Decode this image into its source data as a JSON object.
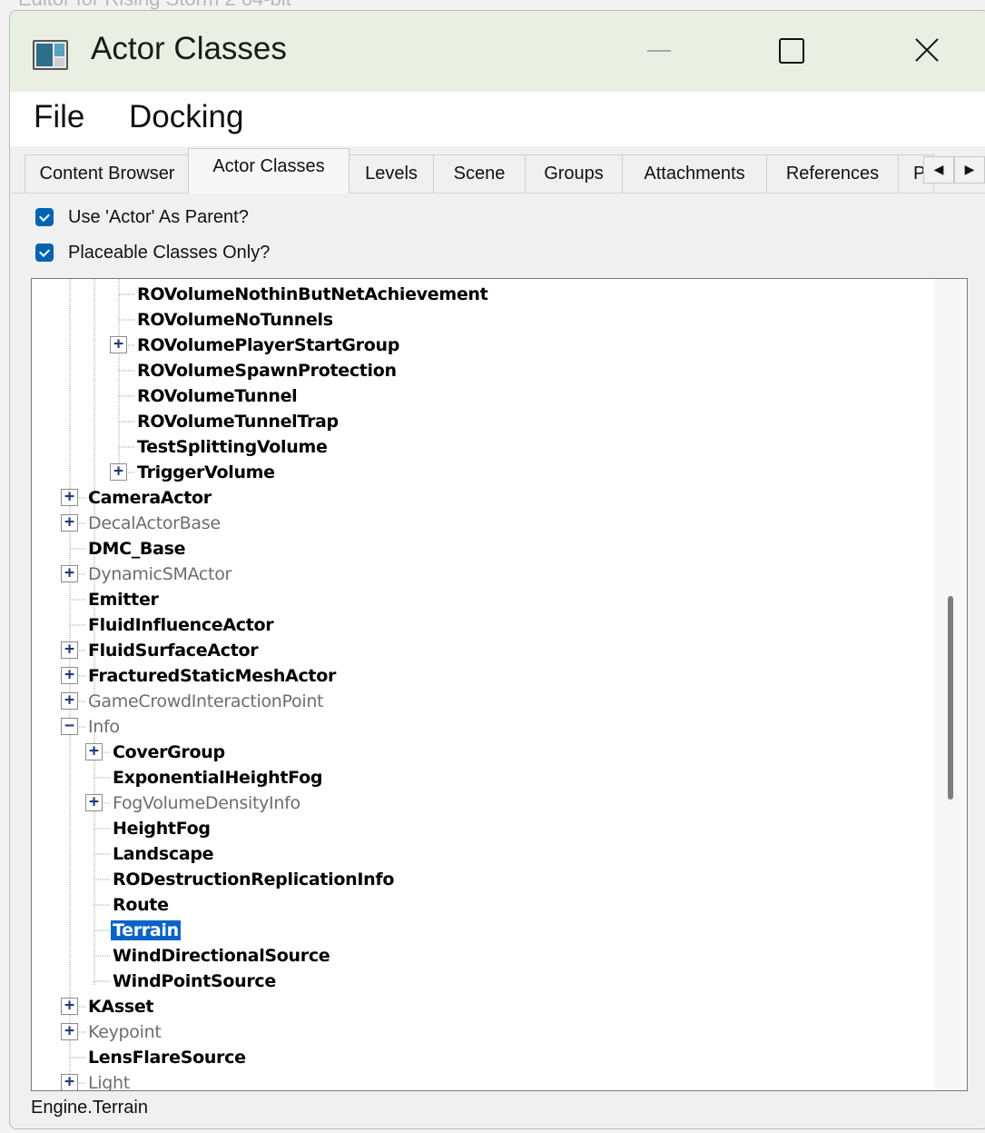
{
  "background_window": {
    "title_fragment": "Editor for Rising Storm 2 64-bit"
  },
  "window": {
    "title": "Actor Classes",
    "icon": "app-window-icon"
  },
  "menu": {
    "file": "File",
    "docking": "Docking"
  },
  "tabs": [
    {
      "label": "Content Browser"
    },
    {
      "label": "Actor Classes"
    },
    {
      "label": "Levels"
    },
    {
      "label": "Scene"
    },
    {
      "label": "Groups"
    },
    {
      "label": "Attachments"
    },
    {
      "label": "References"
    },
    {
      "label": "P"
    }
  ],
  "tab_scroll": {
    "left": "◀",
    "right": "▶"
  },
  "options": {
    "use_actor_parent": {
      "label": "Use 'Actor' As Parent?",
      "checked": true
    },
    "placeable_only": {
      "label": "Placeable Classes Only?",
      "checked": true
    }
  },
  "tree": [
    {
      "label": "ROVolumeNothinButNetAchievement",
      "depth": 2,
      "expander": "",
      "style": "bold"
    },
    {
      "label": "ROVolumeNoTunnels",
      "depth": 2,
      "expander": "",
      "style": "bold"
    },
    {
      "label": "ROVolumePlayerStartGroup",
      "depth": 2,
      "expander": "+",
      "style": "bold"
    },
    {
      "label": "ROVolumeSpawnProtection",
      "depth": 2,
      "expander": "",
      "style": "bold"
    },
    {
      "label": "ROVolumeTunnel",
      "depth": 2,
      "expander": "",
      "style": "bold"
    },
    {
      "label": "ROVolumeTunnelTrap",
      "depth": 2,
      "expander": "",
      "style": "bold"
    },
    {
      "label": "TestSplittingVolume",
      "depth": 2,
      "expander": "",
      "style": "bold"
    },
    {
      "label": "TriggerVolume",
      "depth": 2,
      "expander": "+",
      "style": "bold"
    },
    {
      "label": "CameraActor",
      "depth": 0,
      "expander": "+",
      "style": "bold"
    },
    {
      "label": "DecalActorBase",
      "depth": 0,
      "expander": "+",
      "style": "dim"
    },
    {
      "label": "DMC_Base",
      "depth": 0,
      "expander": "",
      "style": "bold"
    },
    {
      "label": "DynamicSMActor",
      "depth": 0,
      "expander": "+",
      "style": "dim"
    },
    {
      "label": "Emitter",
      "depth": 0,
      "expander": "",
      "style": "bold"
    },
    {
      "label": "FluidInfluenceActor",
      "depth": 0,
      "expander": "",
      "style": "bold"
    },
    {
      "label": "FluidSurfaceActor",
      "depth": 0,
      "expander": "+",
      "style": "bold"
    },
    {
      "label": "FracturedStaticMeshActor",
      "depth": 0,
      "expander": "+",
      "style": "bold"
    },
    {
      "label": "GameCrowdInteractionPoint",
      "depth": 0,
      "expander": "+",
      "style": "dim"
    },
    {
      "label": "Info",
      "depth": 0,
      "expander": "−",
      "style": "dim"
    },
    {
      "label": "CoverGroup",
      "depth": 1,
      "expander": "+",
      "style": "bold"
    },
    {
      "label": "ExponentialHeightFog",
      "depth": 1,
      "expander": "",
      "style": "bold"
    },
    {
      "label": "FogVolumeDensityInfo",
      "depth": 1,
      "expander": "+",
      "style": "dim"
    },
    {
      "label": "HeightFog",
      "depth": 1,
      "expander": "",
      "style": "bold"
    },
    {
      "label": "Landscape",
      "depth": 1,
      "expander": "",
      "style": "bold"
    },
    {
      "label": "RODestructionReplicationInfo",
      "depth": 1,
      "expander": "",
      "style": "bold"
    },
    {
      "label": "Route",
      "depth": 1,
      "expander": "",
      "style": "bold"
    },
    {
      "label": "Terrain",
      "depth": 1,
      "expander": "",
      "style": "bold",
      "selected": true
    },
    {
      "label": "WindDirectionalSource",
      "depth": 1,
      "expander": "",
      "style": "bold"
    },
    {
      "label": "WindPointSource",
      "depth": 1,
      "expander": "",
      "style": "bold"
    },
    {
      "label": "KAsset",
      "depth": 0,
      "expander": "+",
      "style": "bold"
    },
    {
      "label": "Keypoint",
      "depth": 0,
      "expander": "+",
      "style": "dim"
    },
    {
      "label": "LensFlareSource",
      "depth": 0,
      "expander": "",
      "style": "bold"
    },
    {
      "label": "Light",
      "depth": 0,
      "expander": "+",
      "style": "dim"
    }
  ],
  "scroll_position_fraction": 0.45,
  "status": {
    "text": "Engine.Terrain"
  },
  "colors": {
    "selection": "#0a64c8",
    "checkbox": "#0063b1",
    "titlebar": "#e9efe2"
  }
}
